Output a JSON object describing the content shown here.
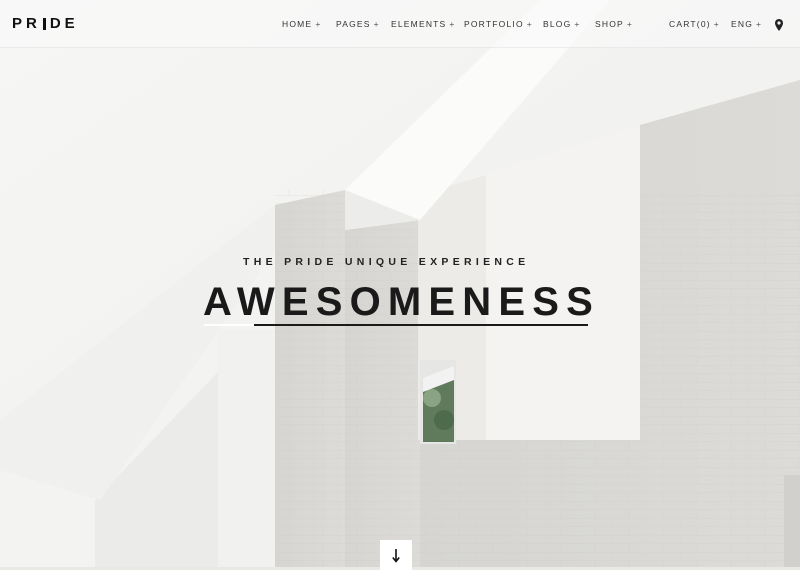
{
  "brand": {
    "logo_text_left": "PR",
    "logo_text_right": "DE"
  },
  "nav": {
    "items": [
      {
        "label": "HOME",
        "suffix": "+"
      },
      {
        "label": "PAGES",
        "suffix": "+"
      },
      {
        "label": "ELEMENTS",
        "suffix": "+"
      },
      {
        "label": "PORTFOLIO",
        "suffix": "+"
      },
      {
        "label": "BLOG",
        "suffix": "+"
      },
      {
        "label": "SHOP",
        "suffix": "+"
      },
      {
        "label": "CART(0)",
        "suffix": "+"
      },
      {
        "label": "ENG",
        "suffix": "+"
      }
    ],
    "location_icon": "map-pin-icon"
  },
  "hero": {
    "subtitle": "THE PRIDE UNIQUE EXPERIENCE",
    "headline": "AWESOMENESS",
    "scroll_icon": "arrow-down-icon"
  },
  "colors": {
    "text_dark": "#1a1a1a",
    "header_bg": "#f7f7f6",
    "wall_light": "#f2f1ef",
    "brick": "#d4d3cf"
  }
}
